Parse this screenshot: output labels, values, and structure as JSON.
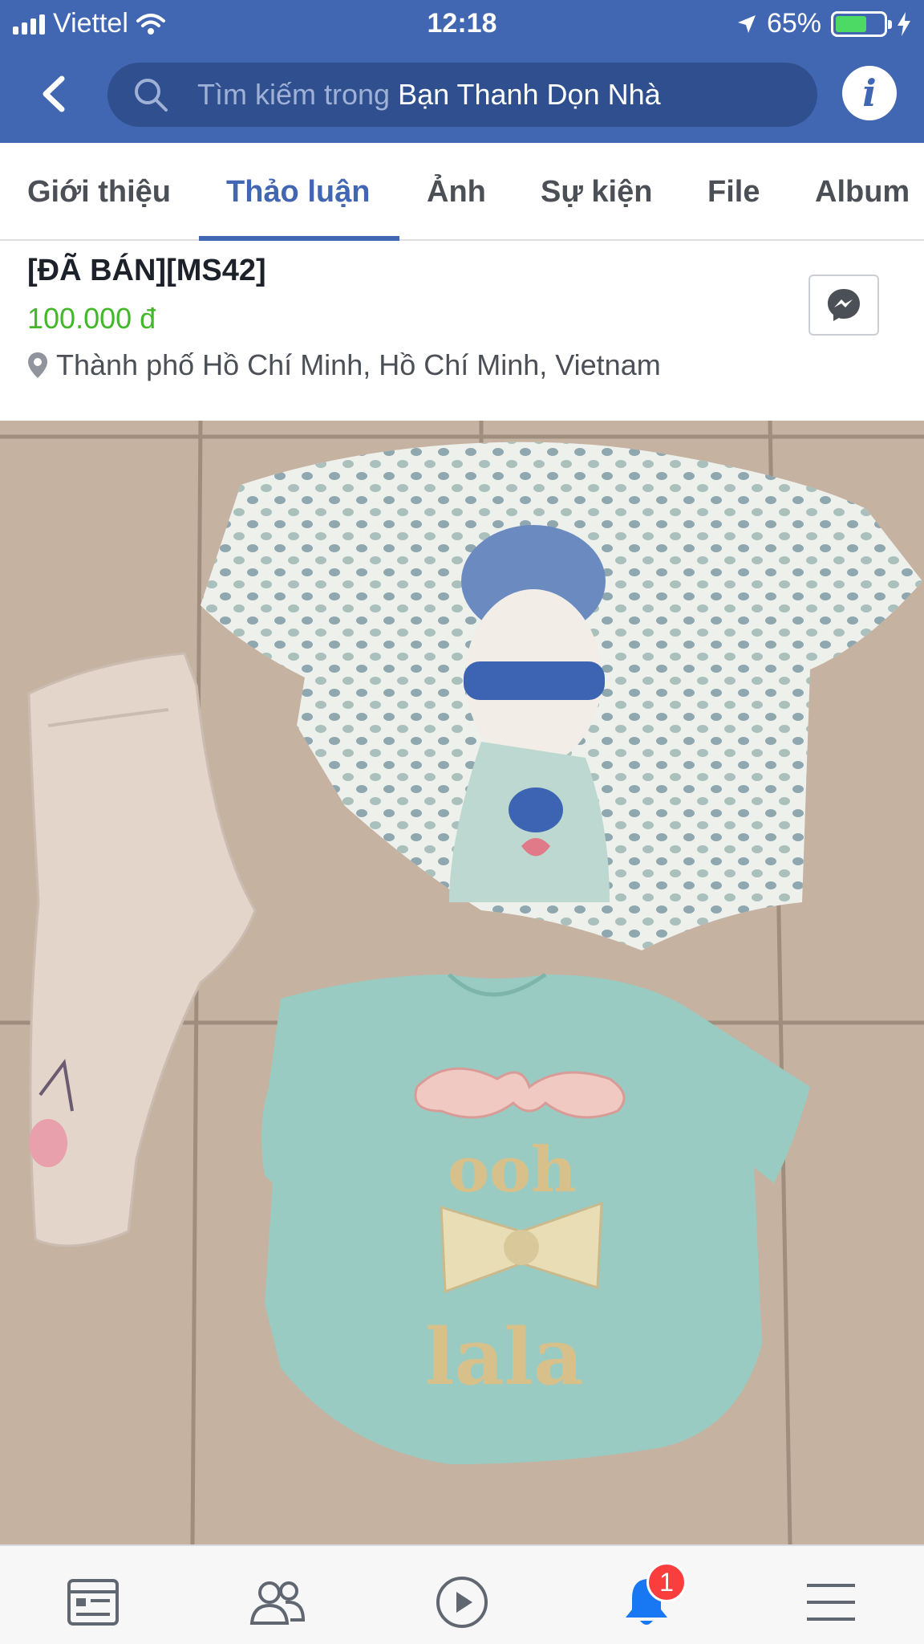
{
  "status_bar": {
    "carrier": "Viettel",
    "time": "12:18",
    "battery_percent_text": "65%",
    "battery_level": 0.65
  },
  "search": {
    "placeholder": "Tìm kiếm trong",
    "group_name": "Bạn Thanh Dọn Nhà"
  },
  "tabs": [
    {
      "label": "Giới thiệu",
      "active": false
    },
    {
      "label": "Thảo luận",
      "active": true
    },
    {
      "label": "Ảnh",
      "active": false
    },
    {
      "label": "Sự kiện",
      "active": false
    },
    {
      "label": "File",
      "active": false
    },
    {
      "label": "Album",
      "active": false
    }
  ],
  "post": {
    "title": "[ĐÃ BÁN][MS42]",
    "price": "100.000 đ",
    "location": "Thành phố Hồ Chí Minh, Hồ Chí Minh, Vietnam"
  },
  "photo": {
    "shirt_text": [
      "ooh",
      "lala"
    ]
  },
  "bottom_nav": {
    "items": [
      "news-feed-icon",
      "friends-icon",
      "watch-icon",
      "notifications-icon",
      "menu-icon"
    ],
    "notification_count": "1"
  },
  "colors": {
    "brand_blue": "#4267b2",
    "price_green": "#42b72a",
    "badge_red": "#fa3e3e"
  }
}
